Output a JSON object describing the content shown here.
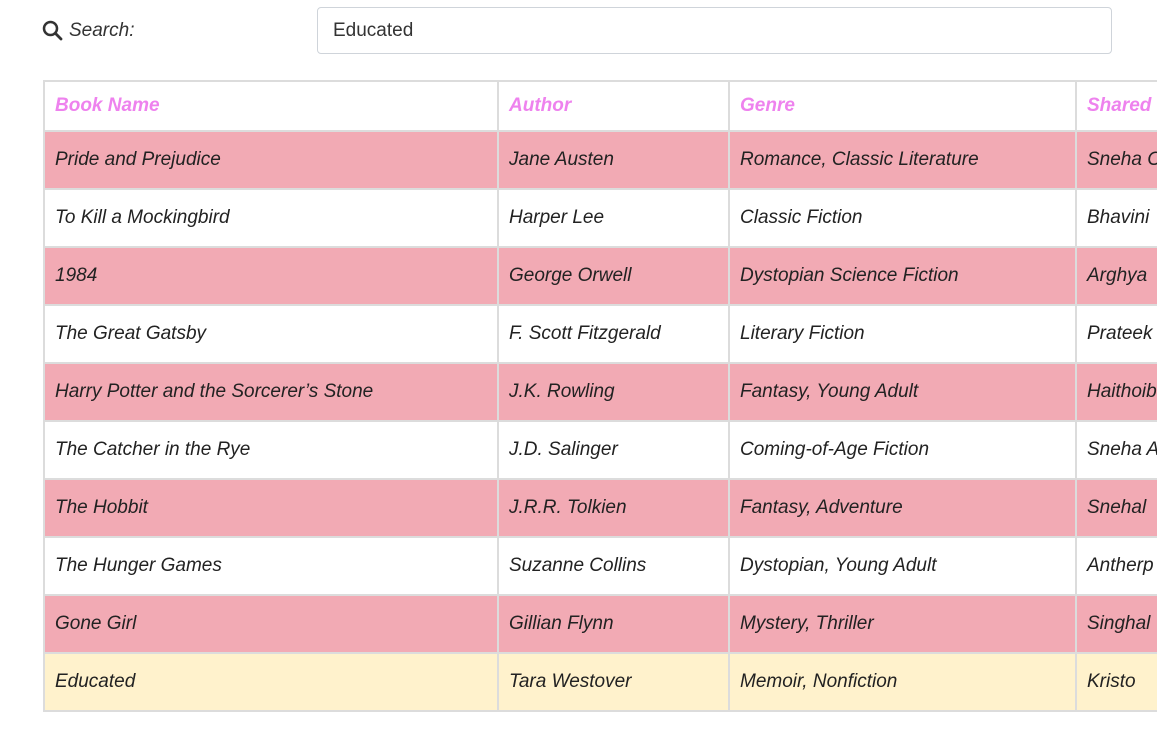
{
  "search": {
    "label": "Search:",
    "value": "Educated",
    "icon": "search-icon"
  },
  "table": {
    "columns": [
      "Book Name",
      "Author",
      "Genre",
      "Shared"
    ],
    "rows": [
      {
        "book": "Pride and Prejudice",
        "author": "Jane Austen",
        "genre": "Romance, Classic Literature",
        "shared": "Sneha C"
      },
      {
        "book": "To Kill a Mockingbird",
        "author": "Harper Lee",
        "genre": "Classic Fiction",
        "shared": "Bhavini"
      },
      {
        "book": "1984",
        "author": "George Orwell",
        "genre": "Dystopian Science Fiction",
        "shared": "Arghya"
      },
      {
        "book": "The Great Gatsby",
        "author": "F. Scott Fitzgerald",
        "genre": "Literary Fiction",
        "shared": "Prateek"
      },
      {
        "book": "Harry Potter and the Sorcerer’s Stone",
        "author": "J.K. Rowling",
        "genre": "Fantasy, Young Adult",
        "shared": "Haithoib"
      },
      {
        "book": "The Catcher in the Rye",
        "author": "J.D. Salinger",
        "genre": "Coming-of-Age Fiction",
        "shared": "Sneha A"
      },
      {
        "book": "The Hobbit",
        "author": "J.R.R. Tolkien",
        "genre": "Fantasy, Adventure",
        "shared": "Snehal"
      },
      {
        "book": "The Hunger Games",
        "author": "Suzanne Collins",
        "genre": "Dystopian, Young Adult",
        "shared": "Antherp"
      },
      {
        "book": "Gone Girl",
        "author": "Gillian Flynn",
        "genre": "Mystery, Thriller",
        "shared": "Singhal"
      },
      {
        "book": "Educated",
        "author": "Tara Westover",
        "genre": "Memoir, Nonfiction",
        "shared": "Kristo"
      }
    ]
  },
  "colors": {
    "header_text": "#ee82ee",
    "row_pink": "#f2aab4",
    "row_white": "#ffffff",
    "row_highlight": "#fff2cc"
  }
}
